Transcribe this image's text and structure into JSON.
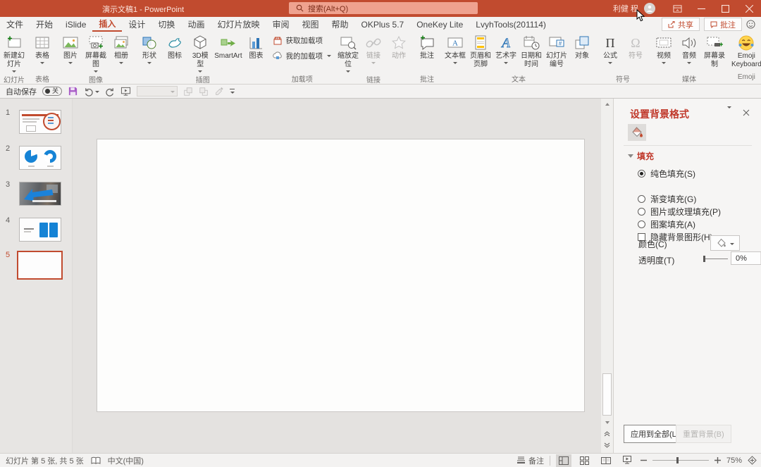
{
  "colors": {
    "accent": "#C14B2F",
    "panel_title": "#C0392B",
    "shape_blue": "#1583D5",
    "save_purple": "#A85CC7"
  },
  "titlebar": {
    "title": "演示文稿1 - PowerPoint",
    "search": "搜索(Alt+Q)",
    "user": "利健 程"
  },
  "tabs": {
    "items": [
      {
        "label": "文件"
      },
      {
        "label": "开始"
      },
      {
        "label": "iSlide"
      },
      {
        "label": "插入",
        "selected": true
      },
      {
        "label": "设计"
      },
      {
        "label": "切换"
      },
      {
        "label": "动画"
      },
      {
        "label": "幻灯片放映"
      },
      {
        "label": "审阅"
      },
      {
        "label": "视图"
      },
      {
        "label": "帮助"
      },
      {
        "label": "OKPlus 5.7"
      },
      {
        "label": "OneKey Lite"
      },
      {
        "label": "LvyhTools(201114)"
      }
    ],
    "share": "共享",
    "comments": "批注"
  },
  "ribbon": {
    "groups": [
      {
        "caption": "幻灯片",
        "items": [
          {
            "label": "新建幻灯片",
            "dd": true
          }
        ]
      },
      {
        "caption": "表格",
        "items": [
          {
            "label": "表格",
            "dd": true
          }
        ]
      },
      {
        "caption": "图像",
        "items": [
          {
            "label": "图片",
            "dd": true
          },
          {
            "label": "屏幕截图",
            "dd": true
          },
          {
            "label": "相册",
            "dd": true
          }
        ]
      },
      {
        "caption": "插图",
        "items": [
          {
            "label": "形状",
            "dd": true
          },
          {
            "label": "图标"
          },
          {
            "label": "3D模型",
            "dd": true
          },
          {
            "label": "SmartArt"
          },
          {
            "label": "图表"
          }
        ]
      },
      {
        "caption": "加载项",
        "items": [
          {
            "label": "获取加载项"
          },
          {
            "label": "我的加载项",
            "dd": true
          }
        ]
      },
      {
        "caption": "链接",
        "items": [
          {
            "label": "缩放定位",
            "dd": true
          },
          {
            "label": "链接",
            "dd": true,
            "disabled": true
          },
          {
            "label": "动作",
            "disabled": true
          }
        ]
      },
      {
        "caption": "批注",
        "items": [
          {
            "label": "批注"
          }
        ]
      },
      {
        "caption": "文本",
        "items": [
          {
            "label": "文本框",
            "dd": true
          },
          {
            "label": "页眉和页脚"
          },
          {
            "label": "艺术字",
            "dd": true
          },
          {
            "label": "日期和时间"
          },
          {
            "label": "幻灯片编号"
          },
          {
            "label": "对象"
          }
        ]
      },
      {
        "caption": "符号",
        "items": [
          {
            "label": "公式",
            "dd": true
          },
          {
            "label": "符号",
            "disabled": true
          }
        ]
      },
      {
        "caption": "媒体",
        "items": [
          {
            "label": "视频",
            "dd": true
          },
          {
            "label": "音频",
            "dd": true
          },
          {
            "label": "屏幕录制"
          }
        ]
      },
      {
        "caption": "Emoji",
        "items": [
          {
            "label": "Emoji Keyboard"
          }
        ]
      }
    ]
  },
  "qat": {
    "autosave": "自动保存",
    "autosave_state": "关"
  },
  "slidepanel": {
    "slides": [
      {
        "num": "1"
      },
      {
        "num": "2"
      },
      {
        "num": "3"
      },
      {
        "num": "4"
      },
      {
        "num": "5",
        "selected": true
      }
    ]
  },
  "panel": {
    "title": "设置背景格式",
    "section_fill": "填充",
    "options": [
      {
        "label": "纯色填充(S)",
        "type": "radio",
        "checked": true
      },
      {
        "label": "渐变填充(G)",
        "type": "radio",
        "checked": false
      },
      {
        "label": "图片或纹理填充(P)",
        "type": "radio",
        "checked": false
      },
      {
        "label": "图案填充(A)",
        "type": "radio",
        "checked": false
      },
      {
        "label": "隐藏背景图形(H)",
        "type": "checkbox",
        "checked": false
      }
    ],
    "color_label": "颜色(C)",
    "transparency_label": "透明度(T)",
    "transparency_value": "0%",
    "apply_all": "应用到全部(L)",
    "reset": "重置背景(B)"
  },
  "statusbar": {
    "slide_info": "幻灯片 第 5 张, 共 5 张",
    "language": "中文(中国)",
    "notes": "备注",
    "zoom": "75%"
  },
  "icons": {
    "search": "magnifier",
    "save": "purple-floppy",
    "undo": "arc-left",
    "redo": "arc-right",
    "autosave_toggle": "pill-off",
    "share": "arrow-out-of-box",
    "comments": "speech-bubble",
    "feedback": "smiley",
    "panel_fill_tab": "paint-bucket",
    "collapse_ribbon": "chevron-up",
    "fit_window": "diamond-arrows",
    "spellcheck": "open-book"
  }
}
